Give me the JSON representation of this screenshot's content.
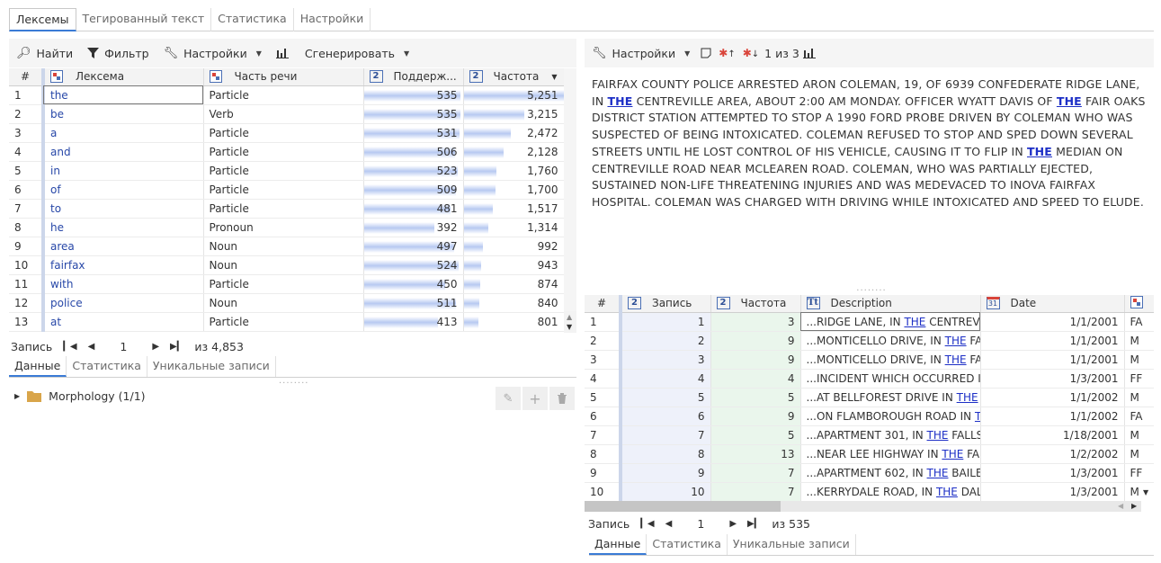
{
  "top_tabs": [
    "Лексемы",
    "Тегированный текст",
    "Статистика",
    "Настройки"
  ],
  "left_toolbar": {
    "find": "Найти",
    "filter": "Фильтр",
    "settings": "Настройки",
    "generate": "Сгенерировать"
  },
  "lexeme_grid": {
    "headers": {
      "num": "#",
      "lexeme": "Лексема",
      "pos": "Часть речи",
      "support": "Поддерж...",
      "freq": "Частота"
    },
    "rows": [
      {
        "n": "1",
        "lexeme": "the",
        "pos": "Particle",
        "support": "535",
        "freq": "5,251",
        "support_pct": 98,
        "freq_pct": 100
      },
      {
        "n": "2",
        "lexeme": "be",
        "pos": "Verb",
        "support": "535",
        "freq": "3,215",
        "support_pct": 98,
        "freq_pct": 61
      },
      {
        "n": "3",
        "lexeme": "a",
        "pos": "Particle",
        "support": "531",
        "freq": "2,472",
        "support_pct": 97,
        "freq_pct": 47
      },
      {
        "n": "4",
        "lexeme": "and",
        "pos": "Particle",
        "support": "506",
        "freq": "2,128",
        "support_pct": 92,
        "freq_pct": 40
      },
      {
        "n": "5",
        "lexeme": "in",
        "pos": "Particle",
        "support": "523",
        "freq": "1,760",
        "support_pct": 95,
        "freq_pct": 33
      },
      {
        "n": "6",
        "lexeme": "of",
        "pos": "Particle",
        "support": "509",
        "freq": "1,700",
        "support_pct": 93,
        "freq_pct": 32
      },
      {
        "n": "7",
        "lexeme": "to",
        "pos": "Particle",
        "support": "481",
        "freq": "1,517",
        "support_pct": 88,
        "freq_pct": 29
      },
      {
        "n": "8",
        "lexeme": "he",
        "pos": "Pronoun",
        "support": "392",
        "freq": "1,314",
        "support_pct": 71,
        "freq_pct": 25
      },
      {
        "n": "9",
        "lexeme": "area",
        "pos": "Noun",
        "support": "497",
        "freq": "992",
        "support_pct": 91,
        "freq_pct": 19
      },
      {
        "n": "10",
        "lexeme": "fairfax",
        "pos": "Noun",
        "support": "524",
        "freq": "943",
        "support_pct": 96,
        "freq_pct": 18
      },
      {
        "n": "11",
        "lexeme": "with",
        "pos": "Particle",
        "support": "450",
        "freq": "874",
        "support_pct": 82,
        "freq_pct": 17
      },
      {
        "n": "12",
        "lexeme": "police",
        "pos": "Noun",
        "support": "511",
        "freq": "840",
        "support_pct": 93,
        "freq_pct": 16
      },
      {
        "n": "13",
        "lexeme": "at",
        "pos": "Particle",
        "support": "413",
        "freq": "801",
        "support_pct": 75,
        "freq_pct": 15
      }
    ]
  },
  "left_pager": {
    "label": "Запись",
    "current": "1",
    "of": "из 4,853"
  },
  "left_subtabs": [
    "Данные",
    "Статистика",
    "Уникальные записи"
  ],
  "tree": {
    "label": "Morphology (1/1)"
  },
  "right_toolbar": {
    "settings": "Настройки",
    "counter": "1 из 3"
  },
  "text_panel": {
    "parts": [
      {
        "t": "FAIRFAX COUNTY POLICE ARRESTED ARON COLEMAN, 19, OF 6939 CONFEDERATE RIDGE LANE, IN ",
        "hl": false
      },
      {
        "t": "THE",
        "hl": true
      },
      {
        "t": " CENTREVILLE AREA, ABOUT 2:00 AM MONDAY. OFFICER WYATT DAVIS OF ",
        "hl": false
      },
      {
        "t": "THE",
        "hl": true
      },
      {
        "t": " FAIR OAKS DISTRICT STATION ATTEMPTED TO STOP A 1990 FORD PROBE DRIVEN BY COLEMAN WHO WAS SUSPECTED OF BEING INTOXICATED. COLEMAN REFUSED TO STOP AND SPED DOWN SEVERAL STREETS UNTIL HE LOST CONTROL OF HIS VEHICLE, CAUSING IT TO FLIP IN ",
        "hl": false
      },
      {
        "t": "THE",
        "hl": true
      },
      {
        "t": " MEDIAN ON CENTREVILLE ROAD NEAR MCLEAREN ROAD. COLEMAN, WHO WAS PARTIALLY EJECTED, SUSTAINED NON-LIFE THREATENING INJURIES AND WAS MEDEVACED TO INOVA FAIRFAX HOSPITAL. COLEMAN WAS CHARGED WITH DRIVING WHILE INTOXICATED AND SPEED TO ELUDE.",
        "hl": false
      }
    ]
  },
  "record_grid": {
    "headers": {
      "num": "#",
      "record": "Запись",
      "freq": "Частота",
      "desc": "Description",
      "date": "Date"
    },
    "rows": [
      {
        "n": "1",
        "record": "1",
        "freq": "3",
        "pre": "...RIDGE LANE, IN ",
        "post": " CENTREVILL",
        "date": "1/1/2001",
        "extra": "FA"
      },
      {
        "n": "2",
        "record": "2",
        "freq": "9",
        "pre": "...MONTICELLO DRIVE, IN ",
        "post": " FALL",
        "date": "1/1/2001",
        "extra": "M"
      },
      {
        "n": "3",
        "record": "3",
        "freq": "9",
        "pre": "...MONTICELLO DRIVE, IN ",
        "post": " FALL",
        "date": "1/1/2001",
        "extra": "M"
      },
      {
        "n": "4",
        "record": "4",
        "freq": "4",
        "pre": "...INCIDENT WHICH OCCURRED IN",
        "post": "",
        "date": "1/3/2001",
        "extra": "FF"
      },
      {
        "n": "5",
        "record": "5",
        "freq": "5",
        "pre": "...AT BELLFOREST DRIVE IN ",
        "post": " ME",
        "date": "1/1/2002",
        "extra": "M"
      },
      {
        "n": "6",
        "record": "6",
        "freq": "9",
        "pre": "...ON FLAMBOROUGH ROAD IN ",
        "post": "",
        "date": "1/1/2002",
        "extra": "FA"
      },
      {
        "n": "7",
        "record": "7",
        "freq": "5",
        "pre": "...APARTMENT 301, IN ",
        "post": " FALLS C",
        "date": "1/18/2001",
        "extra": "M"
      },
      {
        "n": "8",
        "record": "8",
        "freq": "13",
        "pre": "...NEAR LEE HIGHWAY IN ",
        "post": " FALL",
        "date": "1/2/2002",
        "extra": "M"
      },
      {
        "n": "9",
        "record": "9",
        "freq": "7",
        "pre": "...APARTMENT 602, IN ",
        "post": " BAILEYS",
        "date": "1/3/2001",
        "extra": "FF"
      },
      {
        "n": "10",
        "record": "10",
        "freq": "7",
        "pre": "...KERRYDALE ROAD, IN ",
        "post": " DALE",
        "date": "1/3/2001",
        "extra": "M"
      }
    ],
    "the_word": "THE"
  },
  "right_pager": {
    "label": "Запись",
    "current": "1",
    "of": "из 535"
  },
  "right_subtabs": [
    "Данные",
    "Статистика",
    "Уникальные записи"
  ]
}
